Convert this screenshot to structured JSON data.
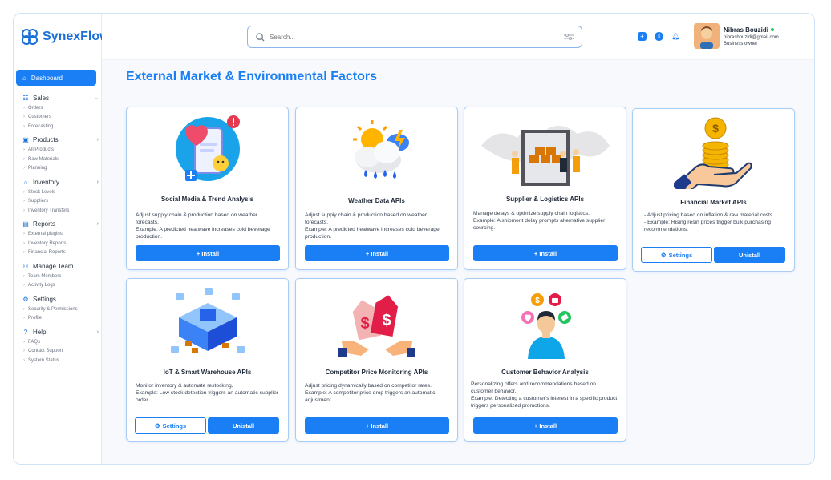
{
  "app": {
    "name": "SynexFlow"
  },
  "search": {
    "placeholder": "Search..."
  },
  "user": {
    "name": "Nibras Bouzidi",
    "email": "nibrasbouzidi@gmail.com",
    "role": "Business owner"
  },
  "nav": {
    "dashboard": "Dashboard",
    "sections": [
      {
        "label": "Sales",
        "icon": "list-icon",
        "items": [
          "Orders",
          "Customers",
          "Forecasting"
        ]
      },
      {
        "label": "Products",
        "icon": "box-icon",
        "items": [
          "All Products",
          "Raw Materials",
          "Planning"
        ]
      },
      {
        "label": "Inventory",
        "icon": "warehouse-icon",
        "items": [
          "Stock Levels",
          "Suppliers",
          "Inventory Transfers"
        ]
      },
      {
        "label": "Reports",
        "icon": "report-icon",
        "items": [
          "External plugins",
          "Inventory Reports",
          "Financial Reports"
        ]
      },
      {
        "label": "Manage Team",
        "icon": "team-icon",
        "items": [
          "Team Members",
          "Activity Logs"
        ]
      },
      {
        "label": "Settings",
        "icon": "gear-icon",
        "items": [
          "Security & Permissions",
          "Profile"
        ]
      },
      {
        "label": "Help",
        "icon": "help-icon",
        "items": [
          "FAQs",
          "Contact Support",
          "System Status"
        ]
      }
    ]
  },
  "main": {
    "title": "External Market & Environmental Factors"
  },
  "cards": [
    {
      "title": "Social Media & Trend Analysis",
      "desc": "Adjust supply chain & production based on weather forecasts.\nExample: A predicted heatwave increases cold beverage production.",
      "install": "+ Install",
      "icon": "social-media-icon"
    },
    {
      "title": "Weather Data APIs",
      "desc": "Adjust supply chain & production based on weather forecasts.\nExample: A predicted heatwave increases cold beverage production.",
      "install": "+ Install",
      "icon": "weather-icon"
    },
    {
      "title": "Supplier & Logistics APIs",
      "desc": "Manage delays & optimize supply chain logistics.\nExample: A shipment delay prompts alternative supplier sourcing.",
      "install": "+ Install",
      "icon": "logistics-icon"
    },
    {
      "title": "Financial Market APIs",
      "bullets": [
        "Adjust pricing based on inflation & raw material costs.",
        "Example: Rising resin prices trigger bulk purchasing recommendations."
      ],
      "settings": "Settings",
      "uninstall": "Unistall",
      "icon": "coins-hand-icon"
    },
    {
      "title": "IoT & Smart Warehouse APIs",
      "desc": "Monitor inventory & automate restocking.\nExample: Low stock detection triggers an automatic supplier order.",
      "settings": "Settings",
      "uninstall": "Unistall",
      "icon": "smart-warehouse-icon"
    },
    {
      "title": "Competitor Price Monitoring APIs",
      "desc": "Adjust pricing dynamically based on competitor rates.\nExample: A competitor price drop triggers an automatic adjustment.",
      "install": "+ Install",
      "icon": "price-tags-icon"
    },
    {
      "title": "Customer Behavior Analysis",
      "desc": "Personalizing offers and recommendations based on customer behavior.\nExample: Detecting a customer's interest in a specific product triggers personalized promotions.",
      "install": "+ Install",
      "icon": "customer-icon"
    }
  ],
  "colors": {
    "accent": "#1a7ef5",
    "border": "#a9cdf3"
  }
}
